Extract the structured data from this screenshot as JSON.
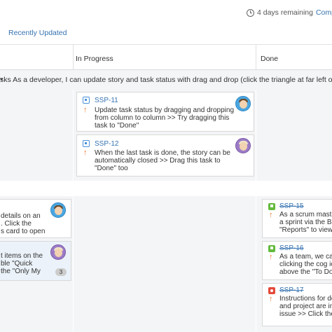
{
  "header": {
    "remaining": "4 days remaining",
    "complete_link": "Compl"
  },
  "quick_filters": {
    "recently_updated": "Recently Updated"
  },
  "columns": {
    "in_progress": "In Progress",
    "done": "Done"
  },
  "swimlane": {
    "caret": "▾",
    "title": "sks As a developer, I can update story and task status with drag and drop (click the triangle at far left of this st"
  },
  "cards": {
    "ssp11": {
      "key": "SSP-11",
      "line1": "Update task status by dragging and dropping",
      "line2": "from column to column >> Try dragging this",
      "line3": "task to \"Done\""
    },
    "ssp12": {
      "key": "SSP-12",
      "line1": "When the last task is done, the story can be",
      "line2": "automatically closed >> Drag this task to",
      "line3": "\"Done\" too"
    },
    "todo1": {
      "line1": "details on an",
      "line2": ". Click the",
      "line3": "s card to open"
    },
    "todo2": {
      "line1": "t items on the",
      "line2": "ble \"Quick",
      "line3": "the \"Only My",
      "badge": "3"
    },
    "ssp15": {
      "key": "SSP-15",
      "line1": "As a scrum maste",
      "line2": "a sprint via the Bo",
      "line3": "\"Reports\" to view"
    },
    "ssp16": {
      "key": "SSP-16",
      "line1": "As a team, we ca",
      "line2": "clicking the cog ic",
      "line3": "above the \"To Do"
    },
    "ssp17": {
      "key": "SSP-17",
      "line1": "Instructions for de",
      "line2": "and project are in",
      "line3": "issue >> Click the"
    }
  },
  "icons": {
    "priority": "↑"
  }
}
